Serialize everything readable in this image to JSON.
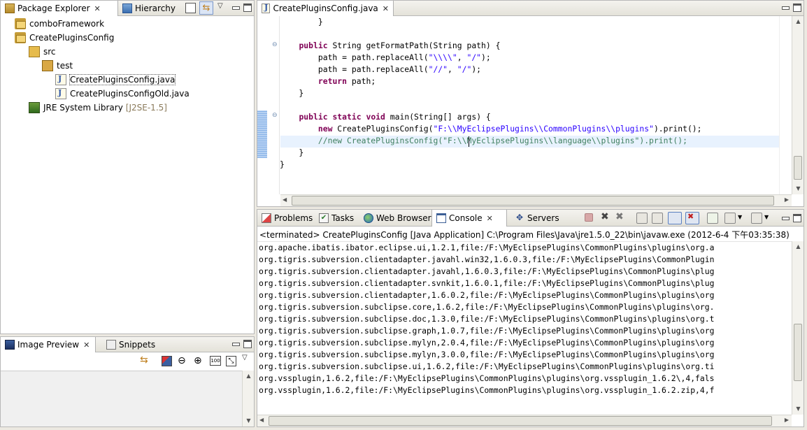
{
  "package_explorer": {
    "tab_label": "Package Explorer",
    "hierarchy_label": "Hierarchy",
    "items": [
      {
        "label": "comboFramework",
        "indent": 0,
        "icon": "project-icon"
      },
      {
        "label": "CreatePluginsConfig",
        "indent": 0,
        "icon": "project-icon"
      },
      {
        "label": "src",
        "indent": 1,
        "icon": "source-folder-icon"
      },
      {
        "label": "test",
        "indent": 2,
        "icon": "package-icon"
      },
      {
        "label": "CreatePluginsConfig.java",
        "indent": 3,
        "icon": "java-file-icon"
      },
      {
        "label": "CreatePluginsConfigOld.java",
        "indent": 3,
        "icon": "java-file-icon"
      },
      {
        "label": "JRE System Library",
        "indent": 1,
        "icon": "library-icon",
        "suffix": "[J2SE-1.5]"
      }
    ]
  },
  "image_preview": {
    "tab_label": "Image Preview",
    "snippets_label": "Snippets"
  },
  "editor": {
    "tab_label": "CreatePluginsConfig.java",
    "lines": [
      {
        "parts": [
          [
            "",
            "        }"
          ]
        ]
      },
      {
        "parts": [
          [
            "",
            ""
          ]
        ]
      },
      {
        "parts": [
          [
            "",
            "    "
          ],
          [
            "kw",
            "public"
          ],
          [
            "",
            " String getFormatPath(String path) {"
          ]
        ]
      },
      {
        "parts": [
          [
            "",
            "        path = path.replaceAll("
          ],
          [
            "str",
            "\"\\\\\\\\\""
          ],
          [
            "",
            ", "
          ],
          [
            "str",
            "\"/\""
          ],
          [
            "",
            ");"
          ]
        ]
      },
      {
        "parts": [
          [
            "",
            "        path = path.replaceAll("
          ],
          [
            "str",
            "\"//\""
          ],
          [
            "",
            ", "
          ],
          [
            "str",
            "\"/\""
          ],
          [
            "",
            ");"
          ]
        ]
      },
      {
        "parts": [
          [
            "",
            "        "
          ],
          [
            "kw",
            "return"
          ],
          [
            "",
            " path;"
          ]
        ]
      },
      {
        "parts": [
          [
            "",
            "    }"
          ]
        ]
      },
      {
        "parts": [
          [
            "",
            ""
          ]
        ]
      },
      {
        "parts": [
          [
            "",
            "    "
          ],
          [
            "kw",
            "public"
          ],
          [
            "",
            " "
          ],
          [
            "kw",
            "static"
          ],
          [
            "",
            " "
          ],
          [
            "kw",
            "void"
          ],
          [
            "",
            " main(String[] args) {"
          ]
        ]
      },
      {
        "parts": [
          [
            "",
            "        "
          ],
          [
            "kw",
            "new"
          ],
          [
            "",
            " CreatePluginsConfig("
          ],
          [
            "str",
            "\"F:\\\\MyEclipsePlugins\\\\CommonPlugins\\\\plugins\""
          ],
          [
            "",
            ").print();"
          ]
        ]
      },
      {
        "parts": [
          [
            "",
            "        "
          ],
          [
            "cm",
            "//new CreatePluginsConfig(\"F:\\\\MyEclipsePlugins\\\\language\\\\plugins\").print();"
          ]
        ]
      },
      {
        "parts": [
          [
            "",
            "    }"
          ]
        ]
      },
      {
        "parts": [
          [
            "",
            "}"
          ]
        ]
      }
    ]
  },
  "bottom_panel": {
    "tabs": [
      {
        "label": "Problems",
        "icon": "problems-icon"
      },
      {
        "label": "Tasks",
        "icon": "tasks-icon"
      },
      {
        "label": "Web Browser",
        "icon": "globe-icon"
      },
      {
        "label": "Console",
        "icon": "console-icon"
      },
      {
        "label": "Servers",
        "icon": "servers-icon"
      }
    ],
    "status_line": "<terminated> CreatePluginsConfig [Java Application] C:\\Program Files\\Java\\jre1.5.0_22\\bin\\javaw.exe (2012-6-4 下午03:35:38)",
    "console_lines": [
      "org.apache.ibatis.ibator.eclipse.ui,1.2.1,file:/F:\\MyEclipsePlugins\\CommonPlugins\\plugins\\org.a",
      "org.tigris.subversion.clientadapter.javahl.win32,1.6.0.3,file:/F:\\MyEclipsePlugins\\CommonPlugin",
      "org.tigris.subversion.clientadapter.javahl,1.6.0.3,file:/F:\\MyEclipsePlugins\\CommonPlugins\\plug",
      "org.tigris.subversion.clientadapter.svnkit,1.6.0.1,file:/F:\\MyEclipsePlugins\\CommonPlugins\\plug",
      "org.tigris.subversion.clientadapter,1.6.0.2,file:/F:\\MyEclipsePlugins\\CommonPlugins\\plugins\\org",
      "org.tigris.subversion.subclipse.core,1.6.2,file:/F:\\MyEclipsePlugins\\CommonPlugins\\plugins\\org.",
      "org.tigris.subversion.subclipse.doc,1.3.0,file:/F:\\MyEclipsePlugins\\CommonPlugins\\plugins\\org.t",
      "org.tigris.subversion.subclipse.graph,1.0.7,file:/F:\\MyEclipsePlugins\\CommonPlugins\\plugins\\org",
      "org.tigris.subversion.subclipse.mylyn,2.0.4,file:/F:\\MyEclipsePlugins\\CommonPlugins\\plugins\\org",
      "org.tigris.subversion.subclipse.mylyn,3.0.0,file:/F:\\MyEclipsePlugins\\CommonPlugins\\plugins\\org",
      "org.tigris.subversion.subclipse.ui,1.6.2,file:/F:\\MyEclipsePlugins\\CommonPlugins\\plugins\\org.ti",
      "org.vssplugin,1.6.2,file:/F:\\MyEclipsePlugins\\CommonPlugins\\plugins\\org.vssplugin_1.6.2\\,4,fals",
      "org.vssplugin,1.6.2,file:/F:\\MyEclipsePlugins\\CommonPlugins\\plugins\\org.vssplugin_1.6.2.zip,4,f"
    ]
  },
  "colors": {
    "keyword": "#7f0055",
    "string": "#2a00ff",
    "comment": "#3f7f5f",
    "current_line": "#e8f2fe"
  }
}
